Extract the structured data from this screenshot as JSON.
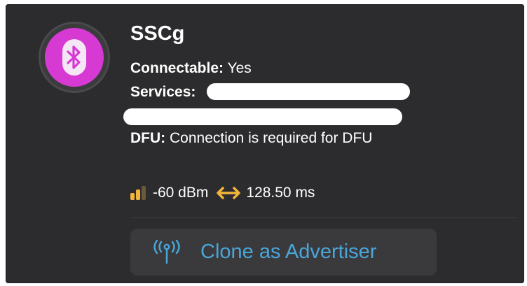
{
  "device": {
    "name": "SSCg",
    "connectable_label": "Connectable:",
    "connectable_value": "Yes",
    "services_label": "Services:",
    "dfu_label": "DFU:",
    "dfu_value": "Connection is required for DFU",
    "icon": "bluetooth-icon",
    "avatar_color": "#d63ad3"
  },
  "signal": {
    "rssi": "-60 dBm",
    "interval": "128.50 ms",
    "strength_bars_filled": 2,
    "strength_bars_total": 3,
    "accent_color": "#f2b53a"
  },
  "actions": {
    "clone_label": "Clone as Advertiser",
    "clone_icon": "antenna-icon",
    "clone_color": "#4aa6d9"
  }
}
